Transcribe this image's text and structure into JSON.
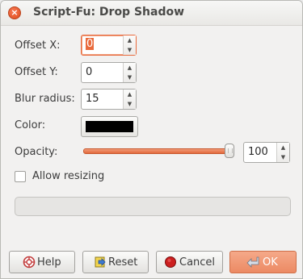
{
  "window": {
    "title": "Script-Fu: Drop Shadow",
    "close_symbol": "×"
  },
  "fields": {
    "offset_x": {
      "label": "Offset X:",
      "value": "0"
    },
    "offset_y": {
      "label": "Offset Y:",
      "value": "0"
    },
    "blur_radius": {
      "label": "Blur radius:",
      "value": "15"
    },
    "color": {
      "label": "Color:",
      "value_hex": "#000000"
    },
    "opacity": {
      "label": "Opacity:",
      "value": "100",
      "level_fraction": 1.0
    },
    "allow_resizing": {
      "label": "Allow resizing",
      "checked": false
    }
  },
  "arrows": {
    "up": "▲",
    "down": "▼"
  },
  "buttons": {
    "help": "Help",
    "reset": "Reset",
    "cancel": "Cancel",
    "ok": "OK"
  },
  "colors": {
    "accent": "#e96b3d",
    "ok_button": "#ec8a63"
  }
}
